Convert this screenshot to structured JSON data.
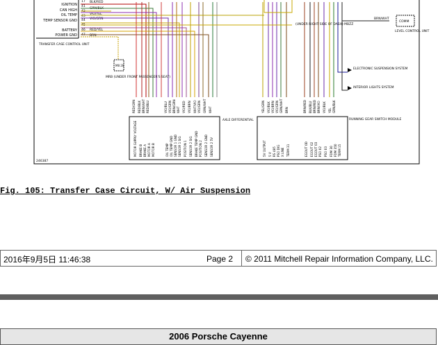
{
  "diagram": {
    "left_labels": [
      "IGNITION",
      "CAN HIGH",
      "OIL TEMP",
      "TEMP SENSOR GND",
      "BATTERY",
      "POWER GND"
    ],
    "pin_numbers": [
      "17",
      "41",
      "42",
      "43",
      "44",
      "45",
      "46",
      "47"
    ],
    "wire_codes_top": [
      "BLK/RED",
      "GRN/BLK",
      "VIO/YEL",
      "VIO/GRN",
      "RED/YEL",
      "BRN"
    ],
    "tcu_label": "TRANSFER CASE CONTROL UNIT",
    "mrb_label": "MRB (UNDER FRONT PASSENGER'S SEAT)",
    "mrb_pin": "M8 28",
    "under_label": "(UNDER RIGHT SIDE OF DASH) MBZZ",
    "brn_wht": "BRN/WHT",
    "level_unit": "LEVEL CONTROL UNIT",
    "comm": "COMM",
    "right_systems": [
      "ELECTRONIC SUSPENSION SYSTEM",
      "INTERIOR LIGHTS SYSTEM"
    ],
    "axle_label": "AXLE DIFFERENTIAL",
    "running_gear": "RUNNING GEAR SWITCH MODULE",
    "corner_id": "246387",
    "left_box_wires": [
      "RED/GRN",
      "RED/BLK",
      "BRN/WHT",
      "RED/BLU",
      "",
      "VIO/BLU",
      "VIO/GRN",
      "BRN/GRN",
      "WHT",
      "VIO/RED",
      "VIO/BRN",
      "WHT/VIO",
      "VIO/GRN",
      "GRN/WHT",
      "WHT"
    ],
    "left_box_pins": [
      "B",
      "",
      "",
      "",
      "",
      "",
      "",
      "",
      "",
      "",
      "",
      "",
      "",
      "",
      "",
      "",
      "",
      "",
      "6"
    ],
    "left_box_signals": [
      "MOTOR SUPPLY VOLTAGE",
      "BRAKE B",
      "BRAKE A",
      "MOTOR A",
      "MOTOR B",
      "",
      "OIL TEMP",
      "OIL TEMP GND",
      "SENSOR 1 GND",
      "SENSOR 1 SIG",
      "POSITION 1",
      "SENSOR 2 SIG",
      "BRAKE TEMP GND",
      "POSITION 2",
      "SENSOR 2 GND",
      "SENSOR 2 5V"
    ],
    "right_box_wires": [
      "YEL/GRN",
      "VIO/BLK",
      "VIO/BRN",
      "VIO/GRN",
      "GRN/WHT",
      "BRN",
      "",
      "BRN/RED",
      "BLK/BLU",
      "BRN/RED",
      "BRN/VIO",
      "VIO/BLK",
      "YEL",
      "GRN/BLK"
    ],
    "right_box_signals": [
      "5V OUTPUT",
      "5 V",
      "RS 485",
      "PSO DIG",
      "X LINE",
      "TERM 31",
      "",
      "EGOUT 0D",
      "EGOUT 02",
      "EGOUT 03",
      "PSO 02",
      "PSO 03",
      "FDM 30",
      "FDM 350",
      "TERM 15"
    ]
  },
  "caption": "Fig. 105: Transfer Case Circuit, W/ Air Suspension",
  "footer": {
    "timestamp": "2016年9月5日  11:46:38",
    "page": "Page 2",
    "copyright": "© 2011 Mitchell Repair Information Company, LLC."
  },
  "next_page_title": "2006 Porsche Cayenne"
}
